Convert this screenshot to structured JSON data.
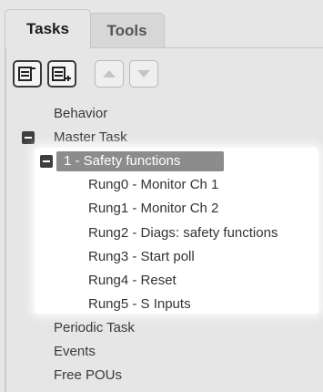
{
  "tabs": [
    {
      "label": "Tasks",
      "active": true
    },
    {
      "label": "Tools",
      "active": false
    }
  ],
  "toolbar": {
    "buttons": [
      {
        "icon": "collapse-all-icon",
        "enabled": true
      },
      {
        "icon": "expand-all-icon",
        "enabled": true
      },
      {
        "icon": "move-up-icon",
        "enabled": false
      },
      {
        "icon": "move-down-icon",
        "enabled": false
      }
    ]
  },
  "tree": {
    "behavior": "Behavior",
    "master_task": "Master Task",
    "section": "1 - Safety functions",
    "rungs": [
      "Rung0 - Monitor Ch 1",
      "Rung1 - Monitor Ch 2",
      "Rung2 - Diags: safety functions",
      "Rung3 - Start poll",
      "Rung4 - Reset",
      "Rung5 - S Inputs"
    ],
    "periodic_task": "Periodic Task",
    "events": "Events",
    "free_pous": "Free POUs"
  },
  "colors": {
    "panel": "#e6e6e6",
    "selection": "#8c8c8c",
    "collapse_box": "#3e3e3e"
  }
}
